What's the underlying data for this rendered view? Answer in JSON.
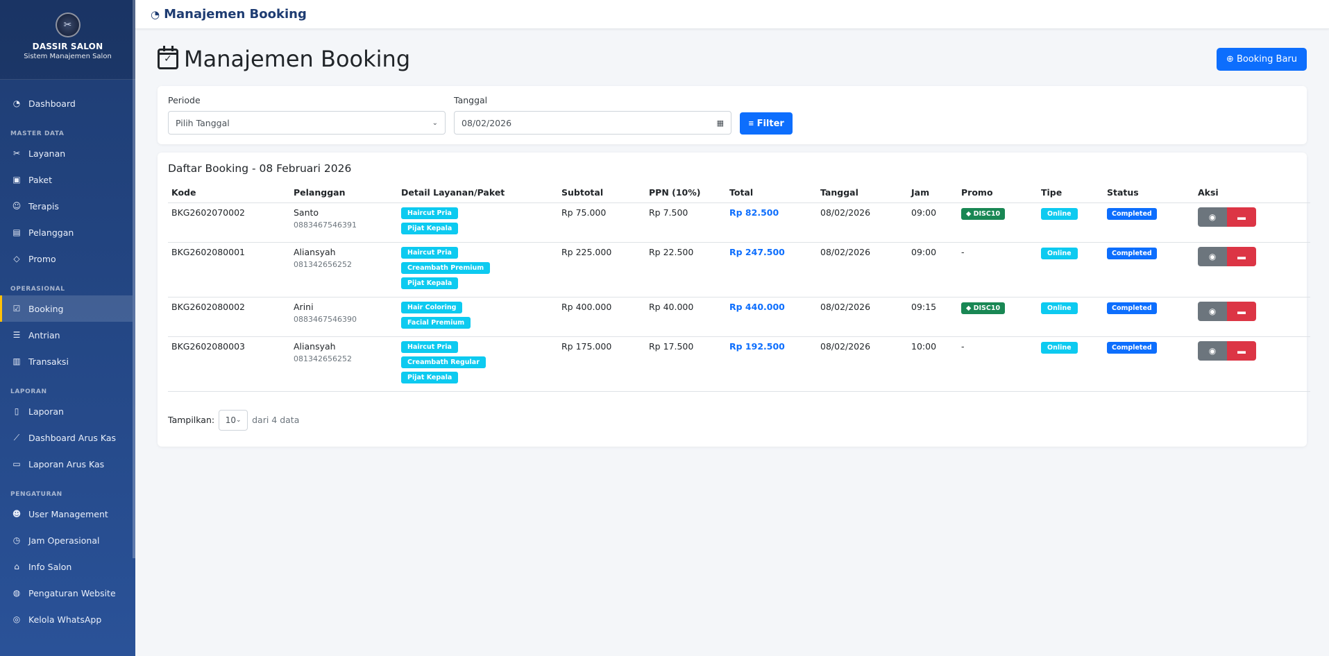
{
  "sidebar": {
    "brand_name": "DASSIR SALON",
    "brand_sub": "Sistem Manajemen Salon",
    "items": [
      {
        "label": "Dashboard",
        "icon": "gauge-icon"
      },
      {
        "section": "MASTER DATA"
      },
      {
        "label": "Layanan",
        "icon": "scissors-icon"
      },
      {
        "label": "Paket",
        "icon": "box-icon"
      },
      {
        "label": "Terapis",
        "icon": "people-icon"
      },
      {
        "label": "Pelanggan",
        "icon": "person-card-icon"
      },
      {
        "label": "Promo",
        "icon": "tag-icon"
      },
      {
        "section": "OPERASIONAL"
      },
      {
        "label": "Booking",
        "icon": "calendar-check-icon",
        "active": true
      },
      {
        "label": "Antrian",
        "icon": "list-icon"
      },
      {
        "label": "Transaksi",
        "icon": "receipt-icon"
      },
      {
        "section": "LAPORAN"
      },
      {
        "label": "Laporan",
        "icon": "document-icon"
      },
      {
        "label": "Dashboard Arus Kas",
        "icon": "line-chart-icon"
      },
      {
        "label": "Laporan Arus Kas",
        "icon": "cash-icon"
      },
      {
        "section": "PENGATURAN"
      },
      {
        "label": "User Management",
        "icon": "users-icon"
      },
      {
        "label": "Jam Operasional",
        "icon": "clock-icon"
      },
      {
        "label": "Info Salon",
        "icon": "shop-icon"
      },
      {
        "label": "Pengaturan Website",
        "icon": "globe-icon"
      },
      {
        "label": "Kelola WhatsApp",
        "icon": "whatsapp-icon"
      }
    ]
  },
  "topbar": {
    "title": "Manajemen Booking"
  },
  "header": {
    "title": "Manajemen Booking",
    "new_button": "Booking Baru"
  },
  "filter": {
    "periode_label": "Periode",
    "periode_value": "Pilih Tanggal",
    "tanggal_label": "Tanggal",
    "tanggal_value": "08/02/2026",
    "button": "Filter"
  },
  "list": {
    "title": "Daftar Booking - 08 Februari 2026",
    "columns": [
      "Kode",
      "Pelanggan",
      "Detail Layanan/Paket",
      "Subtotal",
      "PPN (10%)",
      "Total",
      "Tanggal",
      "Jam",
      "Promo",
      "Tipe",
      "Status",
      "Aksi"
    ],
    "rows": [
      {
        "kode": "BKG2602070002",
        "nama": "Santo",
        "telp": "0883467546391",
        "layanan": [
          "Haircut Pria",
          "Pijat Kepala"
        ],
        "subtotal": "Rp 75.000",
        "ppn": "Rp 7.500",
        "total": "Rp 82.500",
        "tanggal": "08/02/2026",
        "jam": "09:00",
        "promo": "DISC10",
        "tipe": "Online",
        "status": "Completed"
      },
      {
        "kode": "BKG2602080001",
        "nama": "Aliansyah",
        "telp": "081342656252",
        "layanan": [
          "Haircut Pria",
          "Creambath Premium",
          "Pijat Kepala"
        ],
        "subtotal": "Rp 225.000",
        "ppn": "Rp 22.500",
        "total": "Rp 247.500",
        "tanggal": "08/02/2026",
        "jam": "09:00",
        "promo": "-",
        "tipe": "Online",
        "status": "Completed"
      },
      {
        "kode": "BKG2602080002",
        "nama": "Arini",
        "telp": "0883467546390",
        "layanan": [
          "Hair Coloring",
          "Facial Premium"
        ],
        "subtotal": "Rp 400.000",
        "ppn": "Rp 40.000",
        "total": "Rp 440.000",
        "tanggal": "08/02/2026",
        "jam": "09:15",
        "promo": "DISC10",
        "tipe": "Online",
        "status": "Completed"
      },
      {
        "kode": "BKG2602080003",
        "nama": "Aliansyah",
        "telp": "081342656252",
        "layanan": [
          "Haircut Pria",
          "Creambath Regular",
          "Pijat Kepala"
        ],
        "subtotal": "Rp 175.000",
        "ppn": "Rp 17.500",
        "total": "Rp 192.500",
        "tanggal": "08/02/2026",
        "jam": "10:00",
        "promo": "-",
        "tipe": "Online",
        "status": "Completed"
      }
    ]
  },
  "pager": {
    "label": "Tampilkan:",
    "per_page": "10",
    "info": "dari 4 data"
  },
  "colors": {
    "primary": "#0d6efd",
    "info": "#0dcaf0",
    "success": "#198754",
    "danger": "#dc3545",
    "secondary": "#6c757d",
    "sidebar_top": "#1e3c72",
    "sidebar_bottom": "#2a5298",
    "active_marker": "#ffc107"
  }
}
